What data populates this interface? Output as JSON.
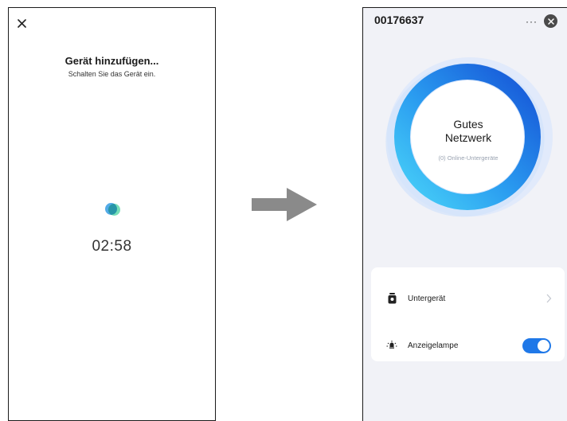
{
  "left_screen": {
    "title": "Gerät hinzufügen...",
    "subtitle": "Schalten Sie das Gerät ein.",
    "timer": "02:58",
    "close_icon": "close-icon"
  },
  "right_screen": {
    "device_id": "00176637",
    "more_label": "···",
    "network": {
      "status_line1": "Gutes",
      "status_line2": "Netzwerk",
      "online_subdevices": "(0) Online-Untergeräte"
    },
    "rows": [
      {
        "label": "Untergerät",
        "icon": "subdevice-icon",
        "action": "chevron-right-icon"
      },
      {
        "label": "Anzeigelampe",
        "icon": "lamp-icon",
        "action": "toggle",
        "enabled": true
      }
    ]
  },
  "colors": {
    "accent": "#1f78e8",
    "ring_outer": "#1a6fe0",
    "ring_inner": "#37c6f4",
    "arrow": "#8a8a8a"
  }
}
